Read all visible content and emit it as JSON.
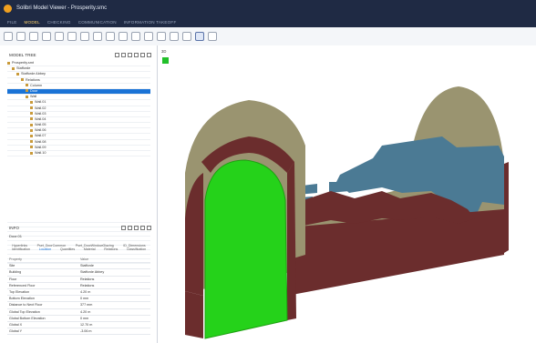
{
  "window": {
    "title": "Solibri Model Viewer - Prosperity.smc"
  },
  "menu": [
    "FILE",
    "MODEL",
    "CHECKING",
    "COMMUNICATION",
    "INFORMATION TAKEOFF"
  ],
  "active_menu": "MODEL",
  "toolbar": {
    "icons": [
      "undo-icon",
      "redo-icon",
      "rotate-icon",
      "zoom-icon",
      "walk-icon",
      "layers-icon",
      "section-icon",
      "filter-icon",
      "model-icon",
      "search-zoom-icon",
      "zoom-in-icon",
      "zoom-out-icon",
      "fit-icon",
      "settings-icon",
      "measure-icon",
      "visibility-icon",
      "camera-icon"
    ],
    "selected_index": 15
  },
  "model_tree": {
    "title": "MODEL TREE",
    "items": [
      {
        "label": "Prosperity.smt",
        "indent": 0
      },
      {
        "label": "Stafforde",
        "indent": 1
      },
      {
        "label": "Stafforde Abbey",
        "indent": 2
      },
      {
        "label": "Relations",
        "indent": 3
      },
      {
        "label": "Column",
        "indent": 4
      },
      {
        "label": "Door",
        "indent": 4,
        "selected": true
      },
      {
        "label": "Wall",
        "indent": 4
      },
      {
        "label": "Wall.01",
        "indent": 5
      },
      {
        "label": "Wall.02",
        "indent": 5
      },
      {
        "label": "Wall.03",
        "indent": 5
      },
      {
        "label": "Wall.04",
        "indent": 5
      },
      {
        "label": "Wall.05",
        "indent": 5
      },
      {
        "label": "Wall.06",
        "indent": 5
      },
      {
        "label": "Wall.07",
        "indent": 5
      },
      {
        "label": "Wall.08",
        "indent": 5
      },
      {
        "label": "Wall.09",
        "indent": 5
      },
      {
        "label": "Wall.10",
        "indent": 5
      }
    ]
  },
  "info": {
    "title": "INFO",
    "selected": "Door.01",
    "tabs_row1": [
      "Hyperlinks",
      "Pset_DoorCommon",
      "Pset_DoorWindowGlazing",
      "ID_Dimensions"
    ],
    "tabs_row2": [
      "Identification",
      "Location",
      "Quantities",
      "Material",
      "Relations",
      "Classification"
    ],
    "active_tab": "Location",
    "columns": [
      "Property",
      "Value"
    ],
    "rows": [
      [
        "Site",
        "Stafforde"
      ],
      [
        "Building",
        "Stafforde Abbey"
      ],
      [
        "Floor",
        "Relations"
      ],
      [
        "Referenced Floor",
        "Relations"
      ],
      [
        "Top Elevation",
        "4.20 m"
      ],
      [
        "Bottom Elevation",
        "0 mm"
      ],
      [
        "Distance to Next Floor",
        "377 mm"
      ],
      [
        "Global Top Elevation",
        "4.20 m"
      ],
      [
        "Global Bottom Elevation",
        "0 mm"
      ],
      [
        "Global X",
        "12.70 m"
      ],
      [
        "Global Y",
        "-3.06 m"
      ]
    ]
  },
  "viewport": {
    "label": "3D"
  },
  "colors": {
    "door_green": "#25d21a",
    "wall_brown": "#6b2d2d",
    "wall_khaki": "#9a9470",
    "wall_blue": "#4b7a94",
    "accent": "#1a73d6"
  }
}
